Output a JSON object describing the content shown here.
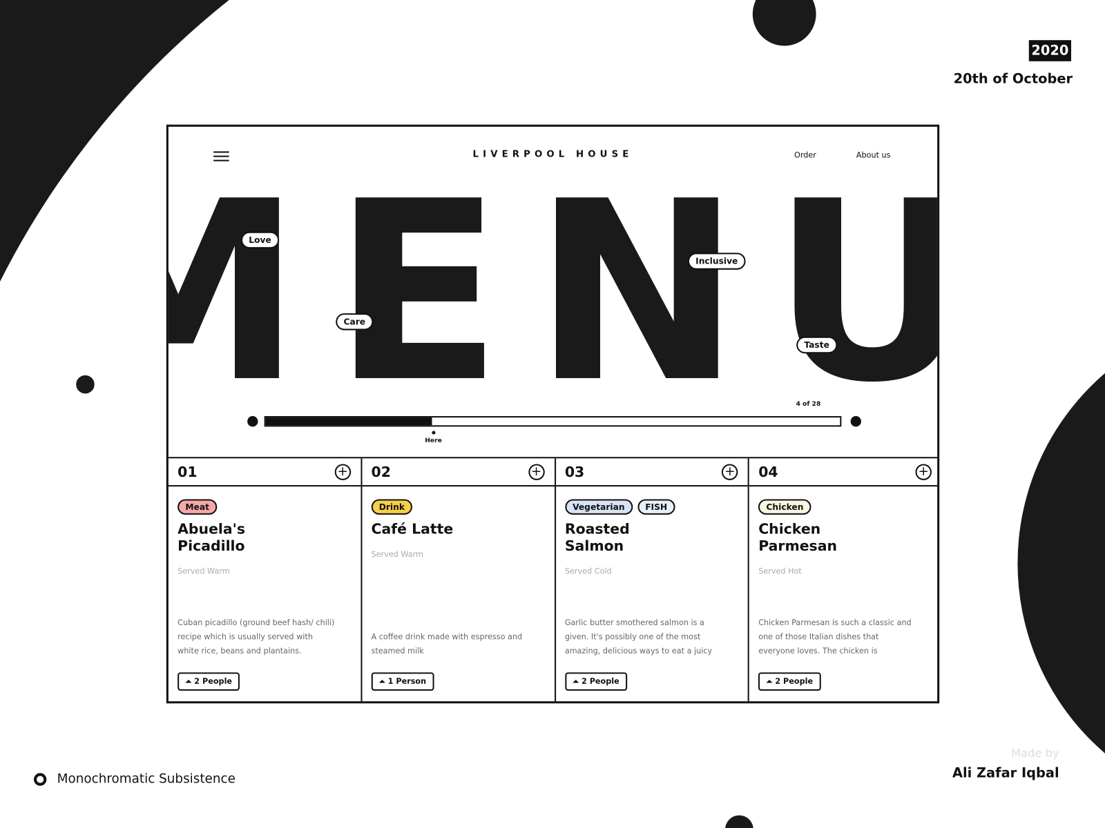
{
  "header": {
    "year": "2020",
    "date": "20th of October"
  },
  "app": {
    "brand": "LIVERPOOL HOUSE",
    "nav": [
      {
        "label": "Order"
      },
      {
        "label": "About us"
      }
    ],
    "hero_word": "MENU",
    "hero_tags": [
      "Love",
      "Care",
      "Inclusive",
      "Taste"
    ],
    "progress": {
      "label": "4 of 28",
      "current": 4,
      "total": 28,
      "marker_label": "Here"
    }
  },
  "items": [
    {
      "number": "01",
      "tags": [
        {
          "label": "Meat",
          "color": "#f4a9a8"
        }
      ],
      "title": "Abuela's Picadillo",
      "served": "Served Warm",
      "description": "Cuban picadillo (ground beef hash/ chili) recipe which is usually served with white rice, beans and plantains.",
      "people": "2 People"
    },
    {
      "number": "02",
      "tags": [
        {
          "label": "Drink",
          "color": "#f7d046"
        }
      ],
      "title": "Café Latte",
      "served": "Served Warm",
      "description": "A coffee drink made with espresso and steamed milk",
      "people": "1 Person"
    },
    {
      "number": "03",
      "tags": [
        {
          "label": "Vegetarian",
          "color": "#d6e4f5"
        },
        {
          "label": "FISH",
          "color": "#e6f0f7"
        }
      ],
      "title": "Roasted Salmon",
      "served": "Served Cold",
      "description": "Garlic butter smothered salmon is a given. It's possibly one of the most amazing, delicious ways to eat a juicy",
      "people": "2 People"
    },
    {
      "number": "04",
      "tags": [
        {
          "label": "Chicken",
          "color": "#f8f6e0"
        }
      ],
      "title": "Chicken Parmesan",
      "served": "Served Hot",
      "description": "Chicken Parmesan is such a classic and one of those Italian dishes that everyone loves. The chicken is",
      "people": "2 People"
    }
  ],
  "footer": {
    "project": "Monochromatic Subsistence",
    "made_by": "Made by",
    "author": "Ali Zafar Iqbal"
  }
}
